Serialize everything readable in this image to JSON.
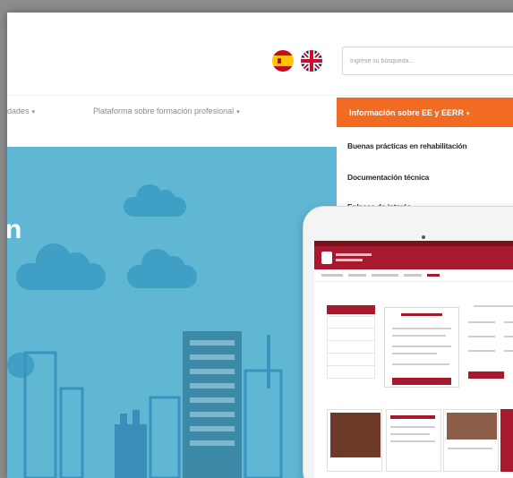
{
  "header": {
    "languages": [
      {
        "code": "es",
        "icon": "spain-flag-icon"
      },
      {
        "code": "en",
        "icon": "uk-flag-icon"
      }
    ],
    "search": {
      "placeholder": "Ingrese su búsqueda..."
    }
  },
  "nav": {
    "items": [
      {
        "label": "idades",
        "caret": "▾"
      },
      {
        "label": "Plataforma sobre formación profesional",
        "caret": "▾"
      },
      {
        "label": "Información sobre EE y EERR",
        "caret": "▾"
      }
    ],
    "dropdown": [
      {
        "label": "Buenas prácticas en rehabilitación"
      },
      {
        "label": "Documentación técnica"
      },
      {
        "label": "Enlaces de interés"
      }
    ]
  },
  "hero": {
    "title_fragment": "n"
  },
  "colors": {
    "accent": "#f26b22",
    "hero_bg": "#5fb7d3",
    "cloud": "#3f9fc4",
    "tablet_site_brand": "#a6192e"
  }
}
